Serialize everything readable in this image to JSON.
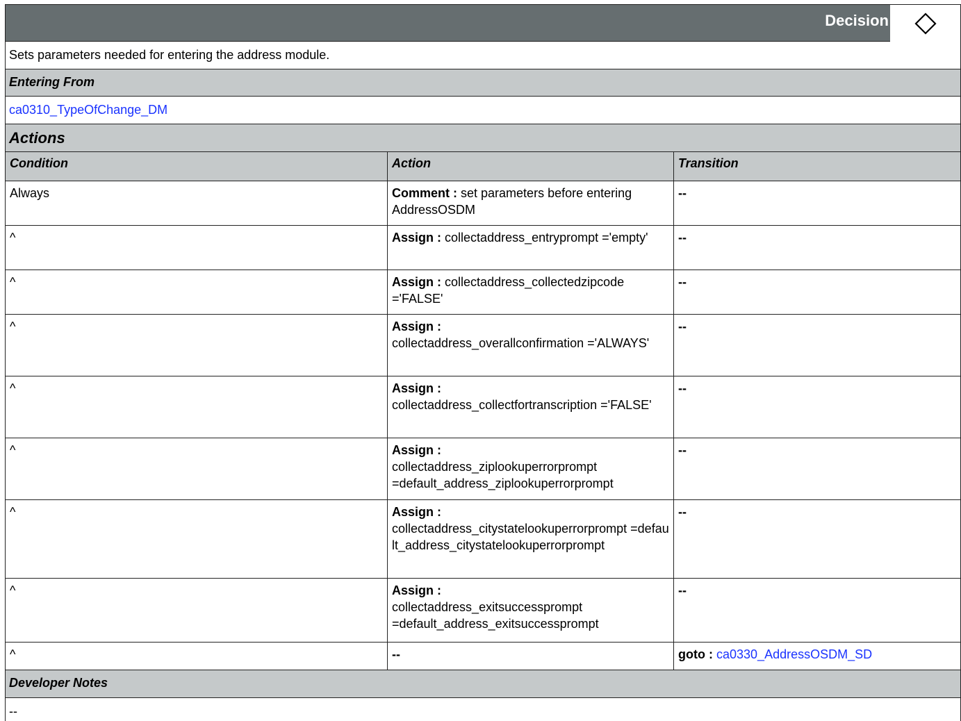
{
  "header": {
    "title": "Decision",
    "icon": "diamond-icon"
  },
  "description": "Sets parameters needed for entering the address module.",
  "entering_from": {
    "label": "Entering From",
    "link": "ca0310_TypeOfChange_DM"
  },
  "actions": {
    "label": "Actions",
    "columns": [
      "Condition",
      "Action",
      "Transition"
    ],
    "rows": [
      {
        "condition": "Always",
        "action_key": "Comment :",
        "action_text": "set parameters before entering AddressOSDM",
        "transition": "--"
      },
      {
        "condition": "^",
        "action_key": "Assign :",
        "action_text": "collectaddress_entryprompt ='empty'",
        "transition": "--"
      },
      {
        "condition": "^",
        "action_key": "Assign :",
        "action_text": "collectaddress_collectedzipcode ='FALSE'",
        "transition": "--"
      },
      {
        "condition": "^",
        "action_key": "Assign :",
        "action_text": "collectaddress_overallconfirmation ='ALWAYS'",
        "transition": "--"
      },
      {
        "condition": "^",
        "action_key": "Assign :",
        "action_text": "collectaddress_collectfortranscription ='FALSE'",
        "transition": "--"
      },
      {
        "condition": "^",
        "action_key": "Assign :",
        "action_text": "collectaddress_ziplookuperrorprompt =default_address_ziplookuperrorprompt",
        "transition": "--"
      },
      {
        "condition": "^",
        "action_key": "Assign :",
        "action_text": "collectaddress_citystatelookuperrorprompt =default_address_citystatelookuperrorprompt",
        "transition": "--"
      },
      {
        "condition": "^",
        "action_key": "Assign :",
        "action_text": "collectaddress_exitsuccessprompt =default_address_exitsuccessprompt",
        "transition": "--"
      },
      {
        "condition": "^",
        "action_key": "",
        "action_text": "--",
        "transition_key": "goto :",
        "transition": "ca0330_AddressOSDM_SD"
      }
    ]
  },
  "developer_notes": {
    "label": "Developer Notes",
    "text": "--"
  }
}
